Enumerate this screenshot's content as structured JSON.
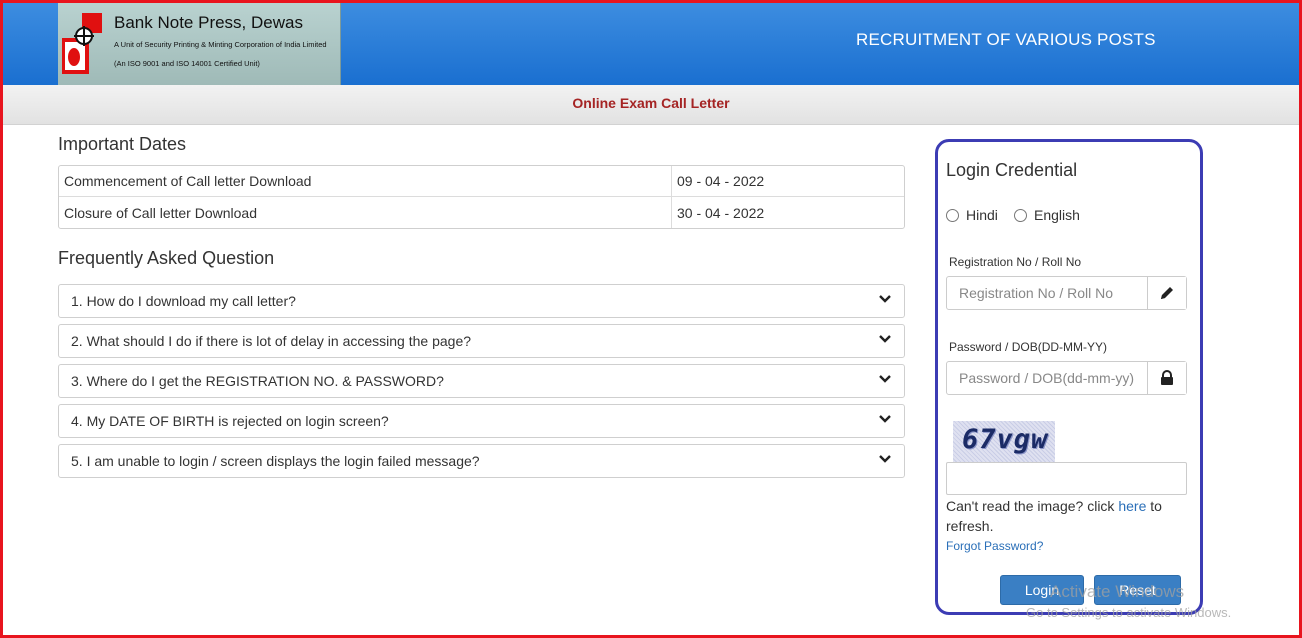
{
  "header": {
    "org_name": "Bank Note Press, Dewas",
    "org_subtitle": "A Unit of Security Printing & Minting Corporation of India Limited",
    "org_cert": "(An ISO 9001 and ISO 14001 Certified Unit)",
    "title": "RECRUITMENT OF VARIOUS POSTS"
  },
  "subbar": {
    "title": "Online Exam Call Letter"
  },
  "important_dates": {
    "heading": "Important Dates",
    "rows": [
      {
        "label": "Commencement of Call letter Download",
        "date": "09 - 04 - 2022"
      },
      {
        "label": "Closure of Call letter Download",
        "date": "30 - 04 - 2022"
      }
    ]
  },
  "faq": {
    "heading": "Frequently Asked Question",
    "items": [
      "1. How do I download my call letter?",
      "2. What should I do if there is lot of delay in accessing the page?",
      "3. Where do I get the REGISTRATION NO. & PASSWORD?",
      "4. My DATE OF BIRTH is rejected on login screen?",
      "5. I am unable to login / screen displays the login failed message?"
    ]
  },
  "login": {
    "title": "Login Credential",
    "lang_hindi": "Hindi",
    "lang_english": "English",
    "reg_label": "Registration No / Roll No",
    "reg_placeholder": "Registration No / Roll No",
    "pwd_label": "Password / DOB(DD-MM-YY)",
    "pwd_placeholder": "Password / DOB(dd-mm-yy)",
    "captcha_text": "67vgw",
    "refresh_prefix": "Can't read the image? click ",
    "refresh_link": "here",
    "refresh_suffix": " to refresh.",
    "forgot": "Forgot Password?",
    "login_button": "Login",
    "reset_button": "Reset"
  },
  "watermark": {
    "line1": "Activate Windows",
    "line2": "Go to Settings to activate Windows."
  },
  "colors": {
    "header_blue": "#1a6fd0",
    "frame_red": "#e8141e",
    "login_border": "#3c3cb4",
    "button_blue": "#3a7fc4",
    "subtitle_red": "#a52424"
  }
}
